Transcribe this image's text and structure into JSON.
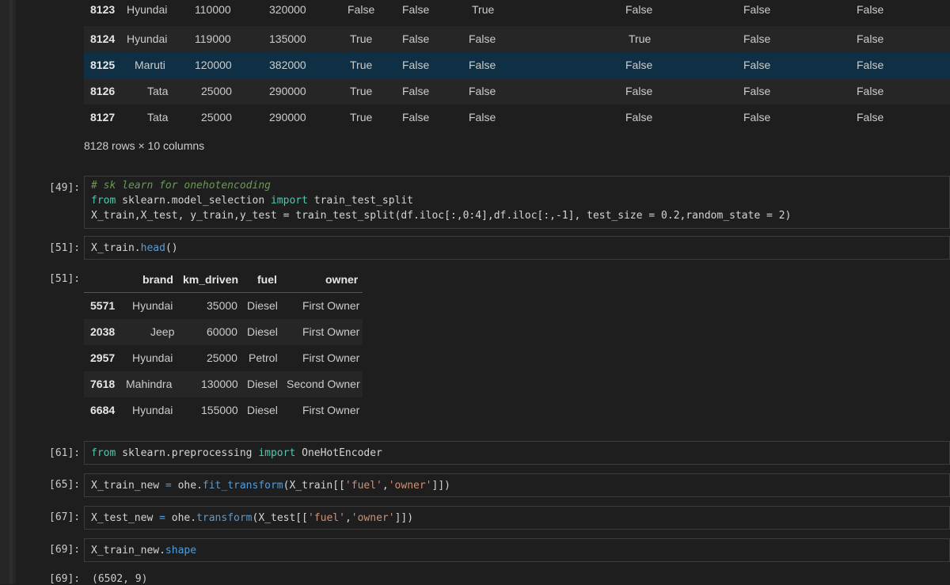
{
  "top_table": {
    "rows": [
      {
        "idx": "8123",
        "brand": "Hyundai",
        "km": "110000",
        "price": "320000",
        "c1": "False",
        "c2": "False",
        "c3": "True",
        "c4": "False",
        "c5": "False",
        "c6": "False"
      },
      {
        "idx": "8124",
        "brand": "Hyundai",
        "km": "119000",
        "price": "135000",
        "c1": "True",
        "c2": "False",
        "c3": "False",
        "c4": "True",
        "c5": "False",
        "c6": "False"
      },
      {
        "idx": "8125",
        "brand": "Maruti",
        "km": "120000",
        "price": "382000",
        "c1": "True",
        "c2": "False",
        "c3": "False",
        "c4": "False",
        "c5": "False",
        "c6": "False"
      },
      {
        "idx": "8126",
        "brand": "Tata",
        "km": "25000",
        "price": "290000",
        "c1": "True",
        "c2": "False",
        "c3": "False",
        "c4": "False",
        "c5": "False",
        "c6": "False"
      },
      {
        "idx": "8127",
        "brand": "Tata",
        "km": "25000",
        "price": "290000",
        "c1": "True",
        "c2": "False",
        "c3": "False",
        "c4": "False",
        "c5": "False",
        "c6": "False"
      }
    ],
    "summary": "8128 rows × 10 columns"
  },
  "cells": {
    "c49": {
      "prompt": "[49]:",
      "l1": "# sk learn for onehotencoding",
      "l2a": "from",
      "l2b": " sklearn.model_selection ",
      "l2c": "import",
      "l2d": " train_test_split",
      "l3": "X_train,X_test, y_train,y_test = train_test_split(df.iloc[:,0:4],df.iloc[:,-1], test_size = 0.2,random_state = 2)"
    },
    "c51": {
      "prompt": "[51]:",
      "a": "X_train.",
      "b": "head",
      "c": "()",
      "out_prompt": "[51]:"
    },
    "c61": {
      "prompt": "[61]:",
      "a": "from",
      "b": " sklearn.preprocessing ",
      "c": "import",
      "d": " OneHotEncoder"
    },
    "c65": {
      "prompt": "[65]:",
      "a": "X_train_new ",
      "b": "=",
      "c": " ohe.",
      "d": "fit_transform",
      "e": "(X_train[[",
      "f": "'fuel'",
      "g": ",",
      "h": "'owner'",
      "i": "]])"
    },
    "c67": {
      "prompt": "[67]:",
      "a": "X_test_new ",
      "b": "=",
      "c": " ohe.",
      "d": "transform",
      "e": "(X_test[[",
      "f": "'fuel'",
      "g": ",",
      "h": "'owner'",
      "i": "]])"
    },
    "c69": {
      "prompt": "[69]:",
      "a": "X_train_new.",
      "b": "shape",
      "out_prompt": "[69]:",
      "out": "(6502, 9)"
    }
  },
  "head_table": {
    "columns": [
      "brand",
      "km_driven",
      "fuel",
      "owner"
    ],
    "rows": [
      {
        "idx": "5571",
        "brand": "Hyundai",
        "km": "35000",
        "fuel": "Diesel",
        "owner": "First Owner"
      },
      {
        "idx": "2038",
        "brand": "Jeep",
        "km": "60000",
        "fuel": "Diesel",
        "owner": "First Owner"
      },
      {
        "idx": "2957",
        "brand": "Hyundai",
        "km": "25000",
        "fuel": "Petrol",
        "owner": "First Owner"
      },
      {
        "idx": "7618",
        "brand": "Mahindra",
        "km": "130000",
        "fuel": "Diesel",
        "owner": "Second Owner"
      },
      {
        "idx": "6684",
        "brand": "Hyundai",
        "km": "155000",
        "fuel": "Diesel",
        "owner": "First Owner"
      }
    ]
  },
  "colors": {
    "background": "#1e1e1e",
    "hover_row": "#0e2f44",
    "keyword": "#4ec9b0",
    "comment": "#6a9955",
    "string": "#ce9178",
    "number": "#b5cea8"
  }
}
